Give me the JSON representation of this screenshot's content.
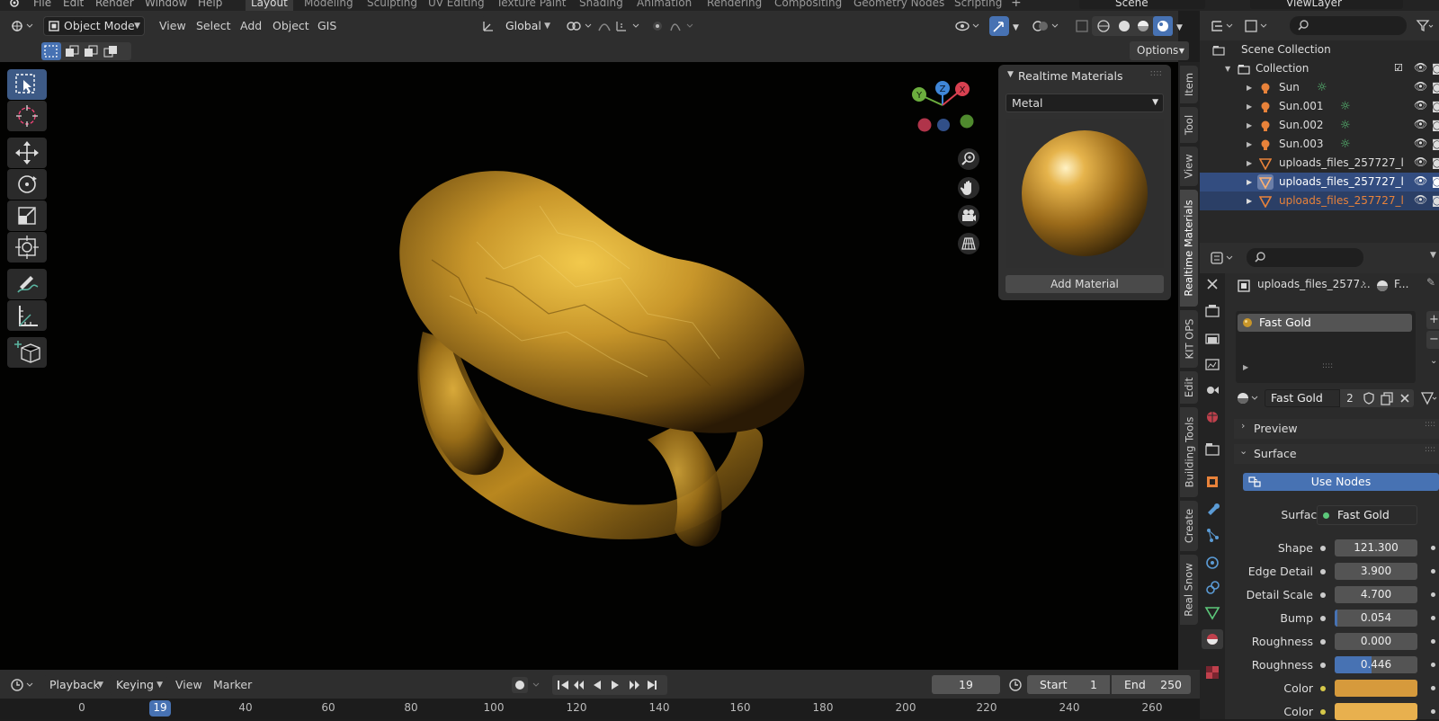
{
  "top_menu": {
    "items": [
      "File",
      "Edit",
      "Render",
      "Window",
      "Help"
    ],
    "workspaces": [
      "Layout",
      "Modeling",
      "Sculpting",
      "UV Editing",
      "Texture Paint",
      "Shading",
      "Animation",
      "Rendering",
      "Compositing",
      "Geometry Nodes",
      "Scripting"
    ],
    "scene": "Scene",
    "view_layer": "ViewLayer"
  },
  "viewport_header": {
    "mode": "Object Mode",
    "menus": [
      "View",
      "Select",
      "Add",
      "Object",
      "GIS"
    ],
    "transform_orientation": "Global",
    "options_label": "Options"
  },
  "side_tabs": [
    "Item",
    "Tool",
    "View",
    "Realtime Materials",
    "KIT OPS",
    "Edit",
    "Building Tools",
    "Create",
    "Real Snow"
  ],
  "realtime_materials": {
    "title": "Realtime Materials",
    "category": "Metal",
    "add_button": "Add Material"
  },
  "gizmo": {
    "x": "X",
    "y": "Y",
    "z": "Z"
  },
  "outliner": {
    "scene_collection": "Scene Collection",
    "collection": "Collection",
    "items": [
      {
        "name": "Sun",
        "type": "light"
      },
      {
        "name": "Sun.001",
        "type": "light"
      },
      {
        "name": "Sun.002",
        "type": "light"
      },
      {
        "name": "Sun.003",
        "type": "light"
      },
      {
        "name": "uploads_files_257727_l",
        "type": "mesh"
      },
      {
        "name": "uploads_files_257727_l",
        "type": "mesh"
      },
      {
        "name": "uploads_files_257727_l",
        "type": "mesh"
      }
    ]
  },
  "properties": {
    "breadcrumb_object": "uploads_files_2577...",
    "breadcrumb_material": "F...",
    "slot_material": "Fast Gold",
    "material_name": "Fast Gold",
    "user_count": "2",
    "preview_label": "Preview",
    "surface_label": "Surface",
    "use_nodes_label": "Use Nodes",
    "surface_field_label": "Surface",
    "surface_shader": "Fast Gold",
    "params": [
      {
        "label": "Shape",
        "value": "121.300",
        "fill": 0
      },
      {
        "label": "Edge Detail",
        "value": "3.900",
        "fill": 0
      },
      {
        "label": "Detail Scale",
        "value": "4.700",
        "fill": 0
      },
      {
        "label": "Bump",
        "value": "0.054",
        "fill": 0.03
      },
      {
        "label": "Roughness",
        "value": "0.000",
        "fill": 0
      },
      {
        "label": "Roughness",
        "value": "0.446",
        "fill": 0.446
      }
    ],
    "colors": [
      {
        "label": "Color",
        "hex": "#d69a3c"
      },
      {
        "label": "Color",
        "hex": "#e8b04e"
      }
    ]
  },
  "timeline": {
    "menus": [
      "Playback",
      "Keying",
      "View",
      "Marker"
    ],
    "current_frame": "19",
    "start_label": "Start",
    "start": "1",
    "end_label": "End",
    "end": "250",
    "ruler": [
      "0",
      "19",
      "40",
      "60",
      "80",
      "100",
      "120",
      "140",
      "160",
      "180",
      "200",
      "220",
      "240",
      "260"
    ]
  },
  "colors": {
    "accent": "#4772b3",
    "selected_row": "#334d80",
    "orange_text": "#e8823a",
    "gold": "#c8962a"
  }
}
